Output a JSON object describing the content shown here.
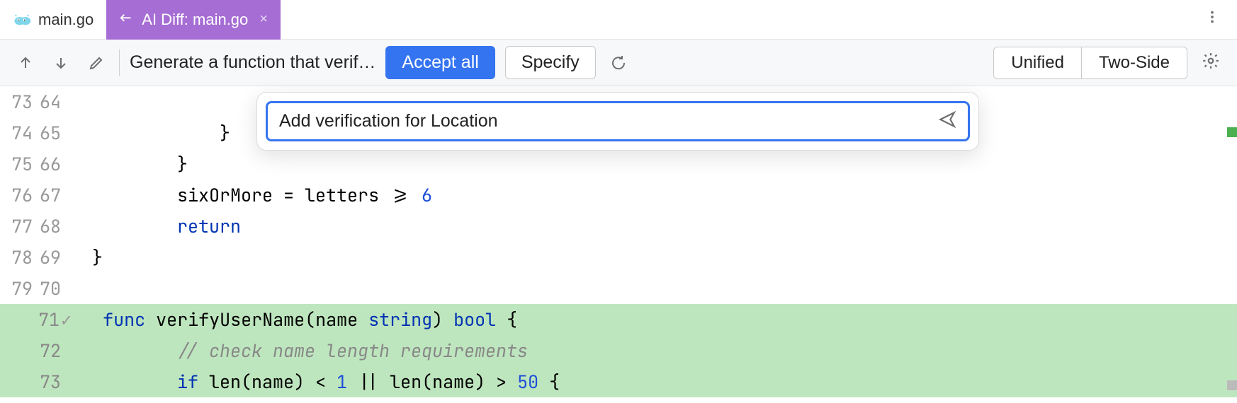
{
  "tabs": {
    "items": [
      {
        "label": "main.go",
        "active": false
      },
      {
        "label": "AI Diff: main.go",
        "active": true
      }
    ]
  },
  "toolbar": {
    "prompt_text": "Generate a function that verif…",
    "accept_label": "Accept all",
    "specify_label": "Specify",
    "view_unified": "Unified",
    "view_twoside": "Two-Side"
  },
  "ai_input": {
    "value": "Add verification for Location"
  },
  "code": {
    "lines": [
      {
        "left": "73",
        "right": "64",
        "added": false,
        "indent": "                ",
        "tokens": [
          {
            "t": "}",
            "c": ""
          }
        ]
      },
      {
        "left": "74",
        "right": "65",
        "added": false,
        "indent": "            ",
        "tokens": [
          {
            "t": "}",
            "c": ""
          }
        ]
      },
      {
        "left": "75",
        "right": "66",
        "added": false,
        "indent": "        ",
        "tokens": [
          {
            "t": "}",
            "c": ""
          }
        ]
      },
      {
        "left": "76",
        "right": "67",
        "added": false,
        "indent": "        ",
        "tokens": [
          {
            "t": "sixOrMore = letters >= ",
            "c": ""
          },
          {
            "t": "6",
            "c": "num"
          }
        ]
      },
      {
        "left": "77",
        "right": "68",
        "added": false,
        "indent": "        ",
        "tokens": [
          {
            "t": "return",
            "c": "kw"
          }
        ]
      },
      {
        "left": "78",
        "right": "69",
        "added": false,
        "indent": "",
        "tokens": [
          {
            "t": "}",
            "c": ""
          }
        ]
      },
      {
        "left": "79",
        "right": "70",
        "added": false,
        "indent": "",
        "tokens": []
      },
      {
        "left": "",
        "right": "71",
        "check": true,
        "added": true,
        "indent": "",
        "tokens": [
          {
            "t": "func",
            "c": "kw"
          },
          {
            "t": " verifyUserName(name ",
            "c": ""
          },
          {
            "t": "string",
            "c": "kw"
          },
          {
            "t": ") ",
            "c": ""
          },
          {
            "t": "bool",
            "c": "kw"
          },
          {
            "t": " {",
            "c": ""
          }
        ]
      },
      {
        "left": "",
        "right": "72",
        "added": true,
        "indent": "        ",
        "tokens": [
          {
            "t": "// check name length requirements",
            "c": "comment"
          }
        ]
      },
      {
        "left": "",
        "right": "73",
        "added": true,
        "indent": "        ",
        "tokens": [
          {
            "t": "if",
            "c": "kw"
          },
          {
            "t": " len(name) < ",
            "c": ""
          },
          {
            "t": "1",
            "c": "num"
          },
          {
            "t": " || len(name) > ",
            "c": ""
          },
          {
            "t": "50",
            "c": "num"
          },
          {
            "t": " {",
            "c": ""
          }
        ]
      }
    ]
  }
}
